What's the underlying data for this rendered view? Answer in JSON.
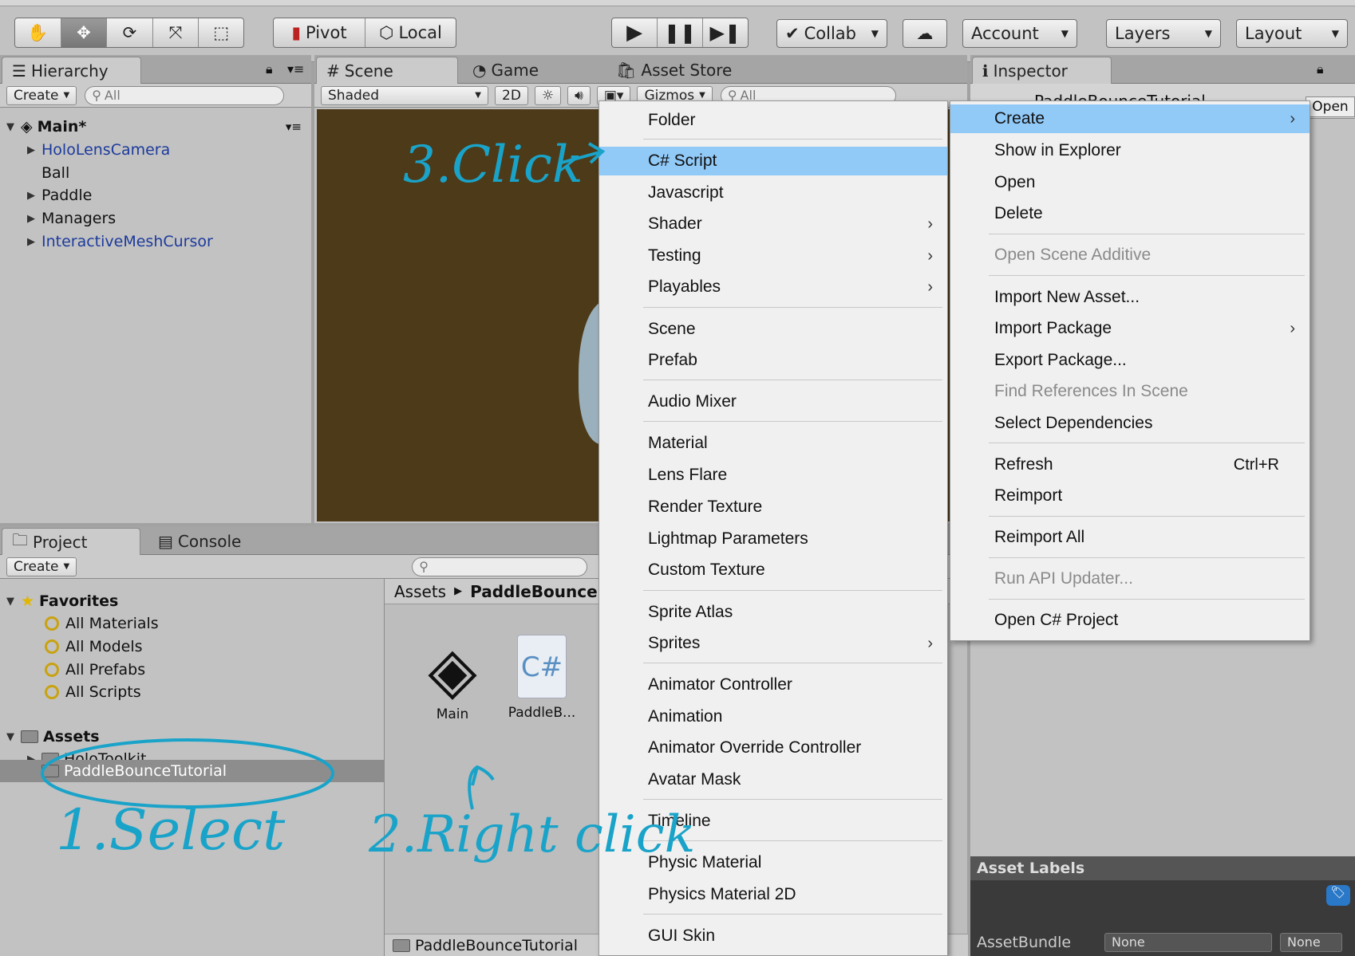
{
  "toolbar": {
    "pivot": "Pivot",
    "local": "Local",
    "collab": "Collab",
    "account": "Account",
    "layers": "Layers",
    "layout": "Layout"
  },
  "hierarchy": {
    "tab": "Hierarchy",
    "create": "Create",
    "search": "All",
    "scene": "Main*",
    "items": [
      "HoloLensCamera",
      "Ball",
      "Paddle",
      "Managers",
      "InteractiveMeshCursor"
    ]
  },
  "scene": {
    "tab_scene": "Scene",
    "tab_game": "Game",
    "tab_store": "Asset Store",
    "shading": "Shaded",
    "mode2d": "2D",
    "gizmos": "Gizmos",
    "search": "All"
  },
  "inspector": {
    "tab": "Inspector",
    "asset_name": "PaddleBounceTutorial",
    "open": "Open",
    "labels_title": "Asset Labels",
    "assetbundle": "AssetBundle",
    "none1": "None",
    "none2": "None"
  },
  "project": {
    "tab_project": "Project",
    "tab_console": "Console",
    "create": "Create",
    "favorites": "Favorites",
    "fav_items": [
      "All Materials",
      "All Models",
      "All Prefabs",
      "All Scripts"
    ],
    "assets": "Assets",
    "asset_items": [
      "HoloToolkit",
      "PaddleBounceTutorial"
    ],
    "breadcrumb_root": "Assets",
    "breadcrumb_current": "PaddleBounce",
    "file1": "Main",
    "file2": "PaddleB...",
    "footer_path": "PaddleBounceTutorial"
  },
  "context_menu": {
    "items": [
      {
        "label": "Create",
        "arrow": "›"
      },
      {
        "label": "Show in Explorer"
      },
      {
        "label": "Open"
      },
      {
        "label": "Delete"
      },
      {
        "label": "Open Scene Additive"
      },
      {
        "label": "Import New Asset..."
      },
      {
        "label": "Import Package",
        "arrow": "›"
      },
      {
        "label": "Export Package..."
      },
      {
        "label": "Find References In Scene"
      },
      {
        "label": "Select Dependencies"
      },
      {
        "label": "Refresh",
        "shortcut": "Ctrl+R"
      },
      {
        "label": "Reimport"
      },
      {
        "label": "Reimport All"
      },
      {
        "label": "Run API Updater..."
      },
      {
        "label": "Open C# Project"
      }
    ]
  },
  "create_menu": {
    "items": [
      {
        "label": "Folder"
      },
      {
        "label": "C# Script"
      },
      {
        "label": "Javascript"
      },
      {
        "label": "Shader",
        "arrow": "›"
      },
      {
        "label": "Testing",
        "arrow": "›"
      },
      {
        "label": "Playables",
        "arrow": "›"
      },
      {
        "label": "Scene"
      },
      {
        "label": "Prefab"
      },
      {
        "label": "Audio Mixer"
      },
      {
        "label": "Material"
      },
      {
        "label": "Lens Flare"
      },
      {
        "label": "Render Texture"
      },
      {
        "label": "Lightmap Parameters"
      },
      {
        "label": "Custom Texture"
      },
      {
        "label": "Sprite Atlas"
      },
      {
        "label": "Sprites",
        "arrow": "›"
      },
      {
        "label": "Animator Controller"
      },
      {
        "label": "Animation"
      },
      {
        "label": "Animator Override Controller"
      },
      {
        "label": "Avatar Mask"
      },
      {
        "label": "Timeline"
      },
      {
        "label": "Physic Material"
      },
      {
        "label": "Physics Material 2D"
      },
      {
        "label": "GUI Skin"
      }
    ]
  },
  "annotations": {
    "step1": "1.Select",
    "step2": "2.Right click",
    "step3": "3.Click"
  },
  "colors": {
    "highlight": "#91c9f7",
    "annotation": "#1aa3c9",
    "scene_bg": "#4d3a18"
  }
}
